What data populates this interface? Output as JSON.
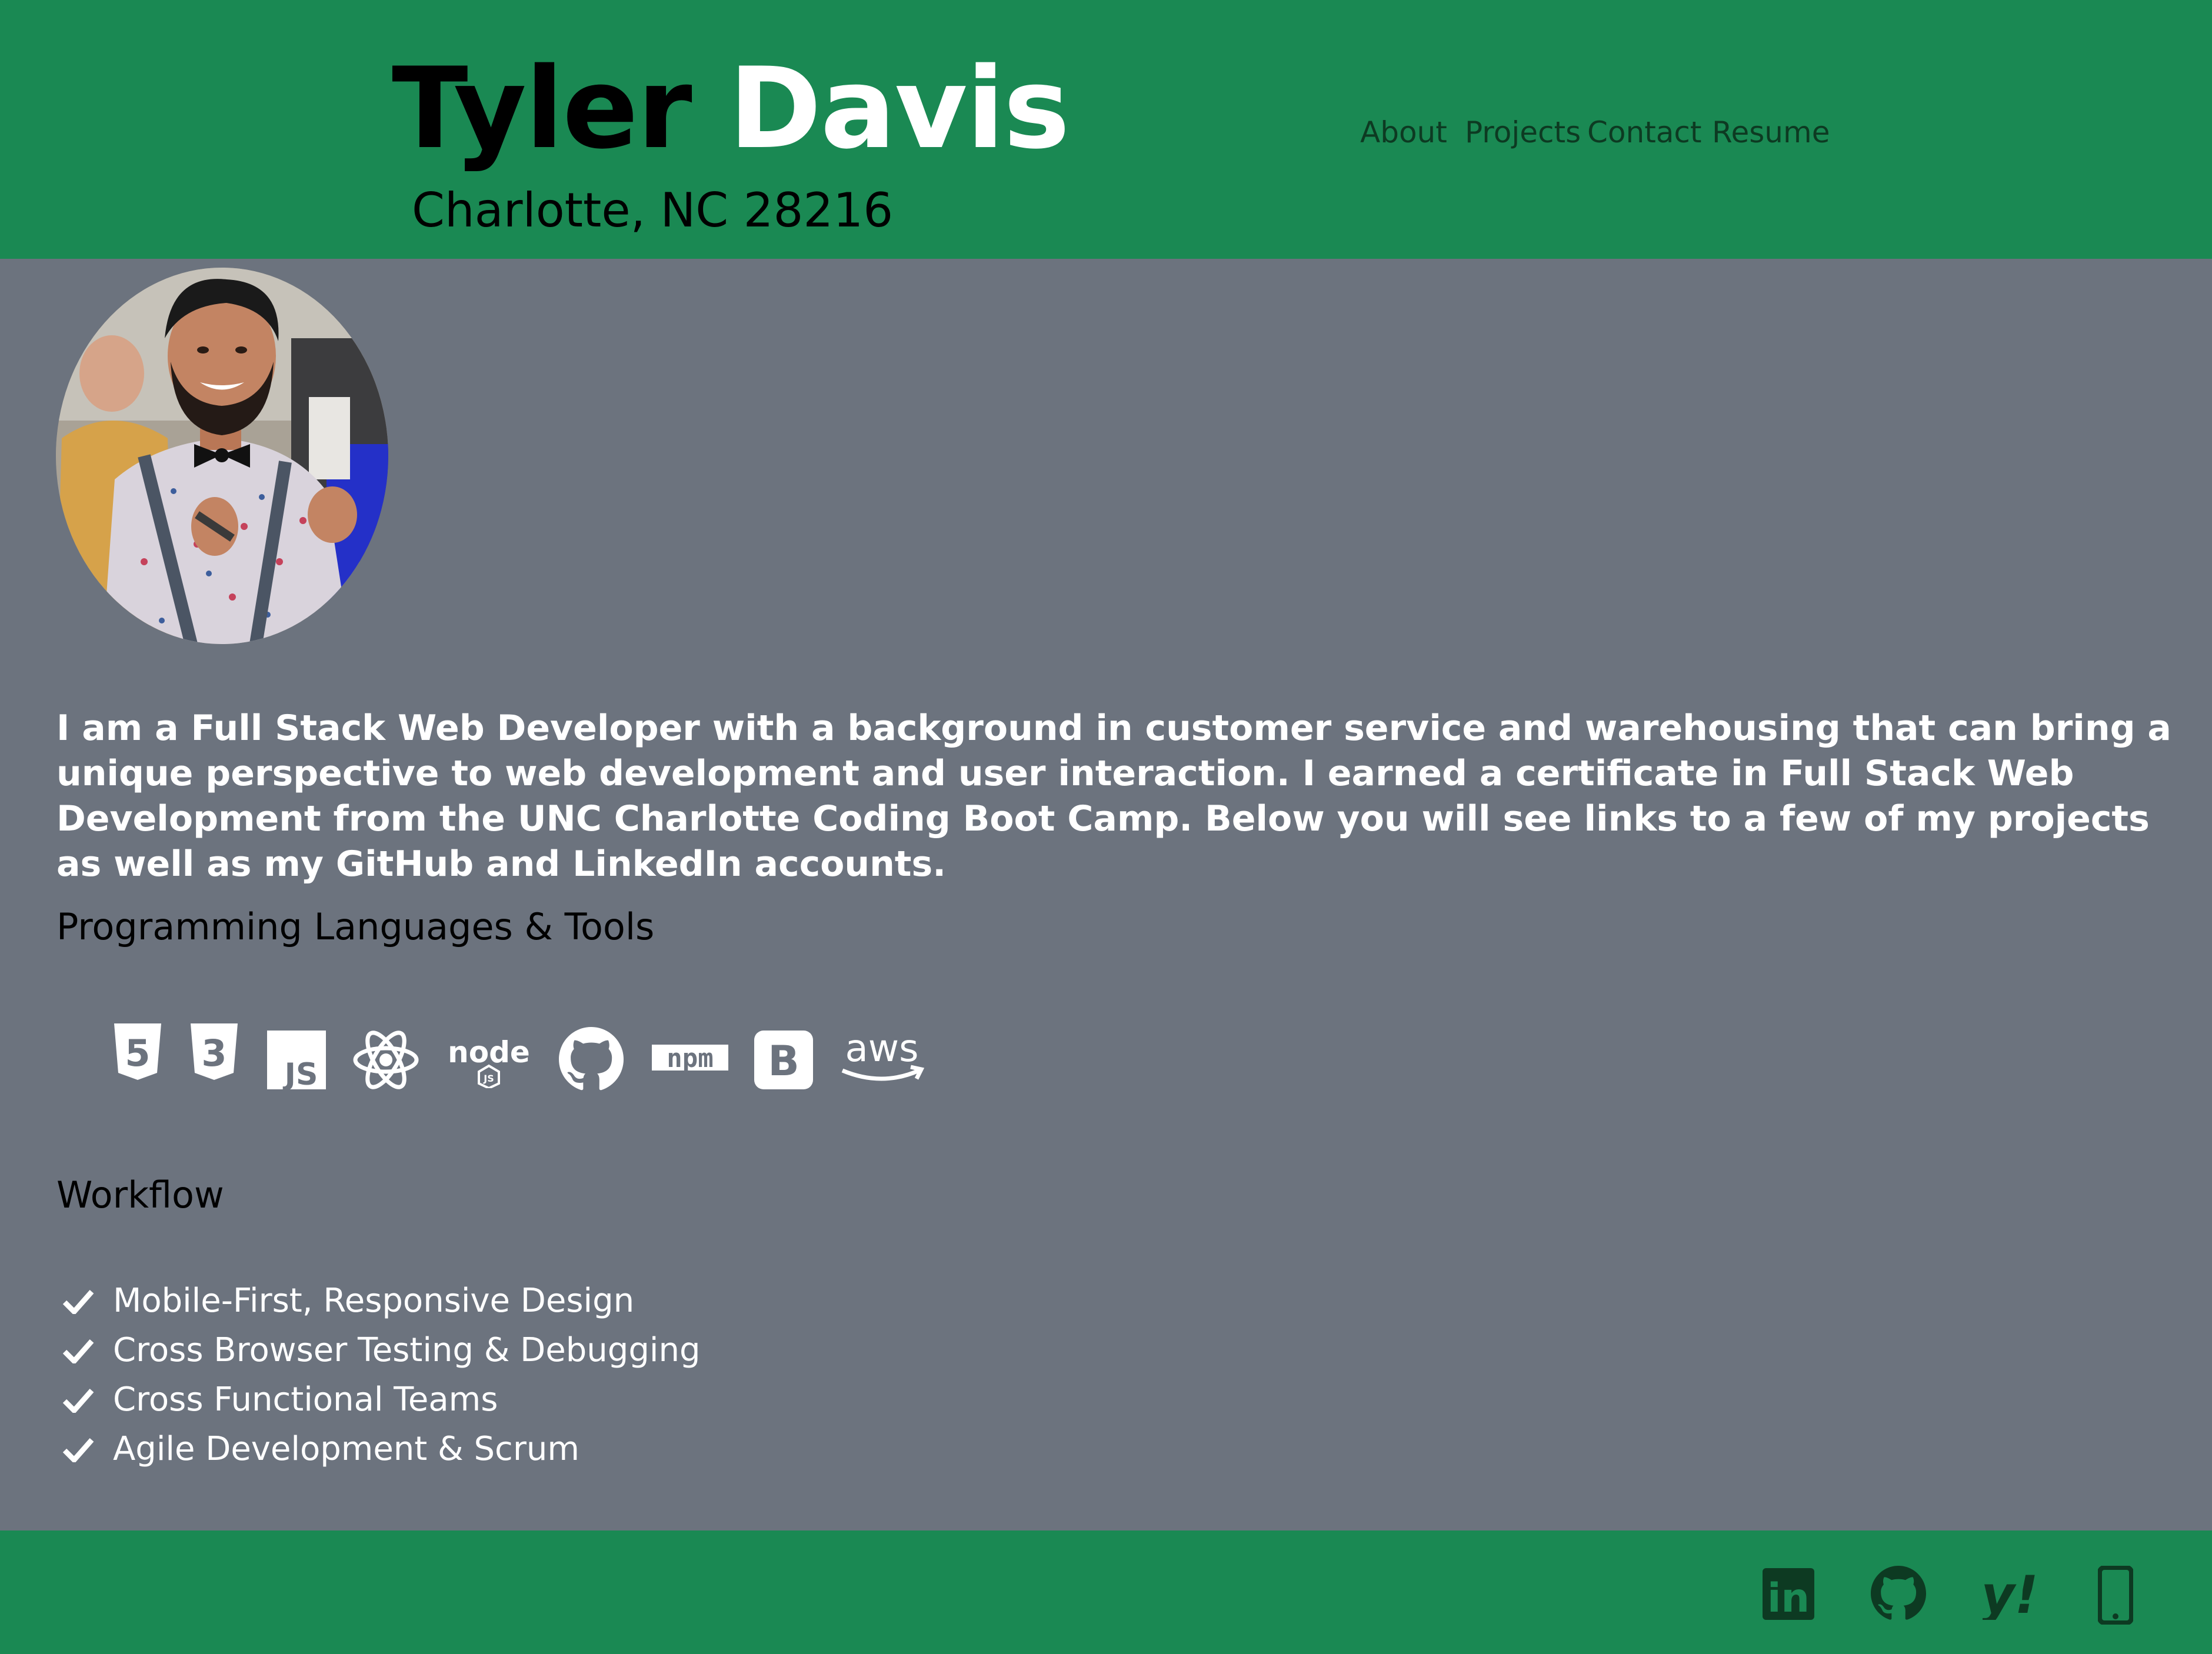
{
  "header": {
    "first_name": "Tyler",
    "last_name": "Davis",
    "location": "Charlotte, NC 28216"
  },
  "nav": {
    "items": [
      {
        "label": "About"
      },
      {
        "label": "Projects"
      },
      {
        "label": "Contact"
      },
      {
        "label": "Resume"
      }
    ]
  },
  "main": {
    "bio": "I am a Full Stack Web Developer with a background in customer service and warehousing that can bring a unique perspective to web development and user interaction. I earned a certificate in Full Stack Web Development from the UNC Charlotte Coding Boot Camp. Below you will see links to a few of my projects as well as my GitHub and LinkedIn accounts.",
    "tools_heading": "Programming Languages & Tools",
    "tools": [
      {
        "icon": "html5-icon",
        "text": "5"
      },
      {
        "icon": "css3-icon",
        "text": "3"
      },
      {
        "icon": "javascript-icon",
        "text": "JS"
      },
      {
        "icon": "react-icon"
      },
      {
        "icon": "nodejs-icon",
        "text": "node",
        "badge": "JS"
      },
      {
        "icon": "github-icon"
      },
      {
        "icon": "npm-icon",
        "text": "npm"
      },
      {
        "icon": "bootstrap-icon",
        "text": "B"
      },
      {
        "icon": "aws-icon",
        "text": "aws"
      }
    ],
    "workflow_heading": "Workflow",
    "workflow": [
      "Mobile-First, Responsive Design",
      "Cross Browser Testing & Debugging",
      "Cross Functional Teams",
      "Agile Development & Scrum"
    ]
  },
  "footer": {
    "icons": [
      "linkedin-icon",
      "github-icon",
      "yahoo-icon",
      "mobile-phone-icon"
    ],
    "linkedin_text": "in",
    "yahoo_text": "y!"
  },
  "colors": {
    "header_bg": "#1a8953",
    "main_bg": "#6c737e",
    "footer_icon": "#0d3a22"
  }
}
